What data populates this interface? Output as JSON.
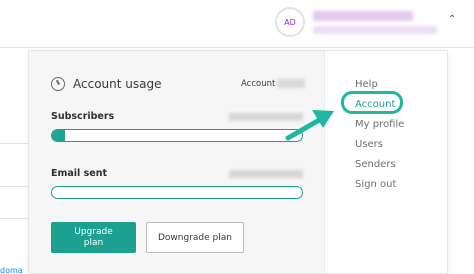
{
  "header": {
    "avatar_initials": "AD",
    "chevron_icon": "chevron-up-icon"
  },
  "usage": {
    "icon": "gauge-icon",
    "title": "Account usage",
    "account_label": "Account",
    "subscribers": {
      "label": "Subscribers",
      "progress_fraction": 0.05
    },
    "emails": {
      "label": "Email sent",
      "progress_fraction": 0.0
    },
    "upgrade_label_line1": "Upgrade",
    "upgrade_label_line2": "plan",
    "downgrade_label": "Downgrade plan"
  },
  "menu": {
    "items": [
      {
        "label": "Help"
      },
      {
        "label": "Account"
      },
      {
        "label": "My profile"
      },
      {
        "label": "Users"
      },
      {
        "label": "Senders"
      },
      {
        "label": "Sign out"
      }
    ]
  },
  "background": {
    "link_fragment": "doma"
  },
  "colors": {
    "accent": "#1ca090",
    "highlight": "#1fb7a2",
    "avatar_text": "#8a2be2",
    "link": "#0092ff"
  }
}
